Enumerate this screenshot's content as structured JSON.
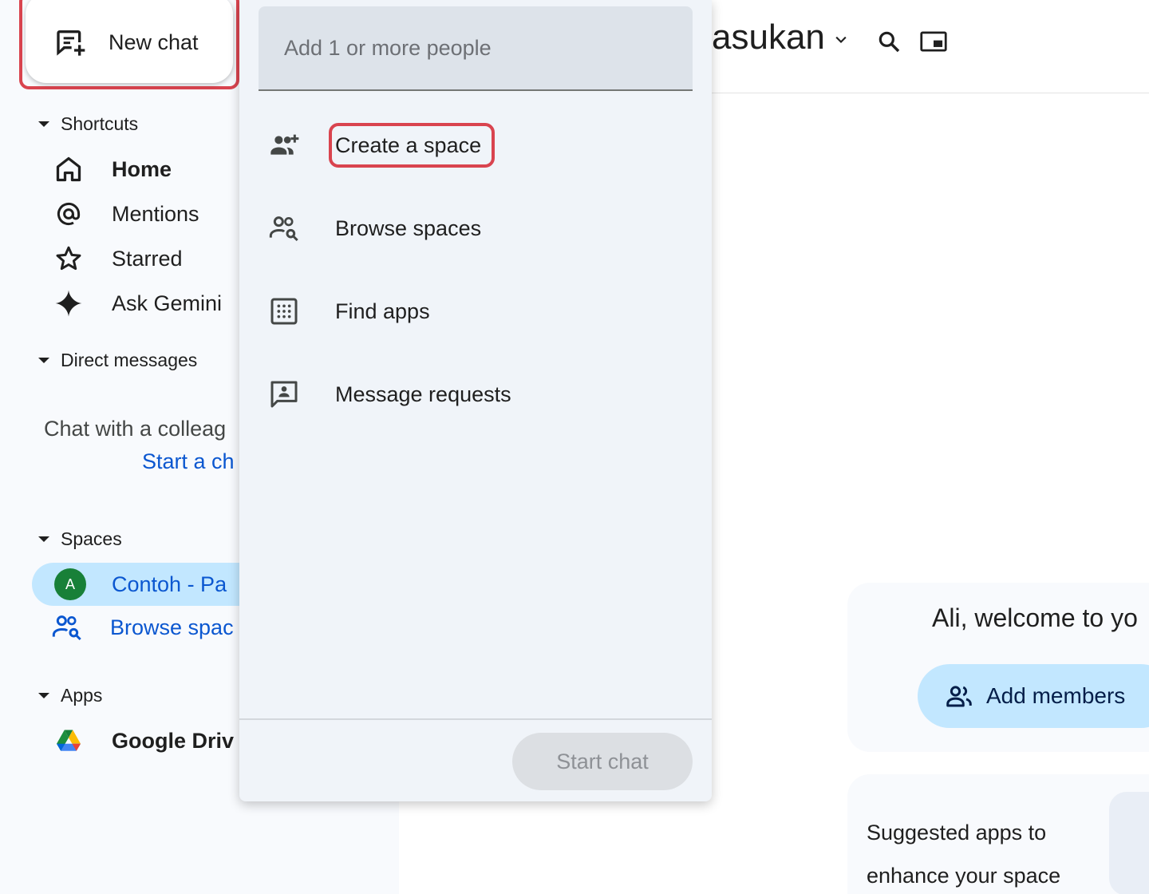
{
  "sidebar": {
    "new_chat_label": "New chat",
    "shortcuts": {
      "header": "Shortcuts",
      "items": [
        {
          "label": "Home",
          "icon": "home-icon",
          "bold": true
        },
        {
          "label": "Mentions",
          "icon": "at-icon"
        },
        {
          "label": "Starred",
          "icon": "star-icon"
        },
        {
          "label": "Ask Gemini",
          "icon": "sparkle-icon"
        }
      ]
    },
    "direct_messages": {
      "header": "Direct messages",
      "empty_text": "Chat with a colleag",
      "start_link": "Start a ch"
    },
    "spaces": {
      "header": "Spaces",
      "active_space": {
        "avatar_letter": "A",
        "label": "Contoh - Pa"
      },
      "browse_label": "Browse spac"
    },
    "apps": {
      "header": "Apps",
      "items": [
        {
          "label": "Google Driv",
          "icon": "google-drive-icon"
        }
      ]
    }
  },
  "main": {
    "title": "asukan",
    "welcome_text": "Ali, welcome to yo",
    "add_members_label": "Add members",
    "suggested_text": "Suggested apps to enhance your space"
  },
  "popup": {
    "people_placeholder": "Add 1 or more people",
    "items": [
      {
        "label": "Create a space",
        "icon": "group-add-icon"
      },
      {
        "label": "Browse spaces",
        "icon": "group-search-icon"
      },
      {
        "label": "Find apps",
        "icon": "apps-grid-icon"
      },
      {
        "label": "Message requests",
        "icon": "message-request-icon"
      }
    ],
    "start_chat_label": "Start chat"
  },
  "colors": {
    "highlight": "#d9444f",
    "accent": "#0b57d0",
    "active_bg": "#c2e7ff",
    "avatar_bg": "#188038"
  }
}
